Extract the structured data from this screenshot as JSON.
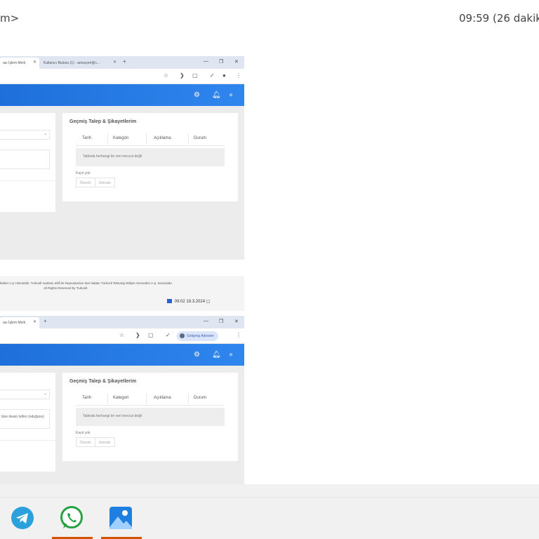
{
  "status": {
    "left_text": "m>",
    "right_text": "09:59 (26 dakik"
  },
  "screenshot1": {
    "tabs": [
      {
        "label": "ası İşlem Merk",
        "active": true
      },
      {
        "label": "Kullanıcı Bulunu (1) - amosyeri@c...",
        "active": false
      }
    ],
    "panel_title": "Geçmiş Talep & Şikayetlerim",
    "columns": [
      "Tarih",
      "Kategori",
      "Açıklama",
      "Durum"
    ],
    "empty_message": "Tabloda herhangi bir veri mevcut değil",
    "no_records": "Kayıt yok",
    "prev_label": "Önceki",
    "next_label": "Sonraki"
  },
  "footer": {
    "line1": "ketleri A.Ş Hizmetidir. Turkcell markası telifi ile Reproduction tüm hakları Turkcell Teknoloji Bilişim Hizmetleri A.Ş. korumadır.",
    "line2": "All Rights Reserved by Turkcell.",
    "time": "09:02",
    "date": "19.3.2024"
  },
  "screenshot2": {
    "tabs": [
      {
        "label": "ası İşlem Merk",
        "active": true
      }
    ],
    "profile_label": "Gelişmiş Adresim",
    "left_textarea": "bize deam lutfen (oduğunu)",
    "panel_title": "Geçmiş Talep & Şikayetlerim",
    "columns": [
      "Tarih",
      "Kategori",
      "Açıklama",
      "Durum"
    ],
    "empty_message": "Tabloda herhangi bir veri mevcut değil",
    "no_records": "Kayıt yok",
    "prev_label": "Önceki",
    "next_label": "Sonraki"
  },
  "dock": {
    "apps": [
      {
        "name": "telegram-icon",
        "color": "#2aa1da"
      },
      {
        "name": "whatsapp-icon",
        "color": "#25a244"
      },
      {
        "name": "photos-icon",
        "color": "#1e7fe0"
      }
    ]
  },
  "colors": {
    "accent": "#1e6fd9",
    "running_indicator": "#d35400"
  }
}
